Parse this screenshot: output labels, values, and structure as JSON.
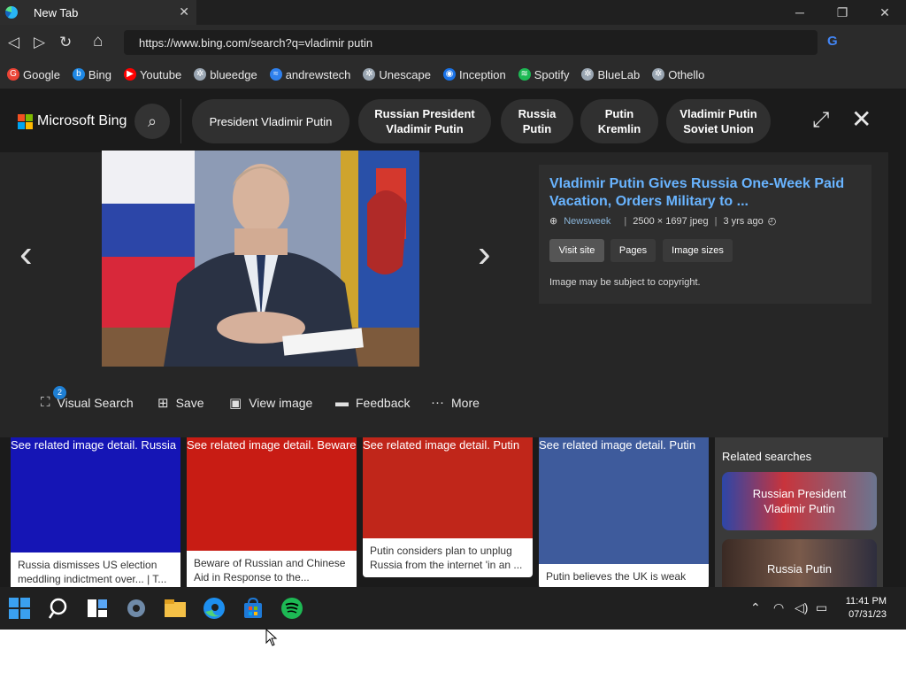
{
  "browser": {
    "tab_title": "New Tab",
    "tab_close": "✕",
    "url": "https://www.bing.com/search?q=vladimir putin",
    "bookmarks": [
      {
        "label": "Google",
        "icon": "google-icon",
        "color": "#ea4335"
      },
      {
        "label": "Bing",
        "icon": "bing-icon",
        "color": "#1e88e5"
      },
      {
        "label": "Youtube",
        "icon": "youtube-icon",
        "color": "#ff0000"
      },
      {
        "label": "blueedge",
        "icon": "gear-icon",
        "color": "#9aa6b2"
      },
      {
        "label": "andrewstech",
        "icon": "link-icon",
        "color": "#2f80ed"
      },
      {
        "label": "Unescape",
        "icon": "gear-icon",
        "color": "#9aa6b2"
      },
      {
        "label": "Inception",
        "icon": "inception-icon",
        "color": "#1a73e8"
      },
      {
        "label": "Spotify",
        "icon": "spotify-icon",
        "color": "#1db954"
      },
      {
        "label": "BlueLab",
        "icon": "gear-icon",
        "color": "#9aa6b2"
      },
      {
        "label": "Othello",
        "icon": "gear-icon",
        "color": "#9aa6b2"
      }
    ]
  },
  "bing": {
    "brand": "Microsoft Bing",
    "chips": [
      {
        "line1": "President Vladimir Putin",
        "line2": ""
      },
      {
        "line1": "Russian President",
        "line2": "Vladimir Putin"
      },
      {
        "line1": "Russia",
        "line2": "Putin"
      },
      {
        "line1": "Putin",
        "line2": "Kremlin"
      },
      {
        "line1": "Vladimir Putin",
        "line2": "Soviet Union"
      }
    ]
  },
  "detail": {
    "title": "Vladimir Putin Gives Russia One-Week Paid Vacation, Orders Military to ...",
    "source": "Newsweek",
    "size": "2500 × 1697 jpeg",
    "age": "3 yrs ago",
    "buttons": {
      "visit": "Visit site",
      "pages": "Pages",
      "sizes": "Image sizes"
    },
    "copyright": "Image may be subject to copyright."
  },
  "actions": {
    "badge": "2",
    "visual_search": "Visual Search",
    "save": "Save",
    "view_image": "View image",
    "feedback": "Feedback",
    "more": "More"
  },
  "cards": [
    {
      "alt": "See related image detail. Russia",
      "caption": "Russia dismisses US election meddling indictment over... | T...",
      "color": "#1515b5"
    },
    {
      "alt": "See related image detail. Beware",
      "caption": "Beware of Russian and Chinese Aid in Response to the...",
      "color": "#c81c14"
    },
    {
      "alt": "See related image detail. Putin",
      "caption": "Putin considers plan to unplug Russia from the internet 'in an ...",
      "color": "#c0261a"
    },
    {
      "alt": "See related image detail. Putin",
      "caption": "Putin believes the UK is weak",
      "color": "#3e5b9c"
    }
  ],
  "related": {
    "heading": "Related searches",
    "items": [
      {
        "line1": "Russian President",
        "line2": "Vladimir Putin"
      },
      {
        "line1": "Russia Putin",
        "line2": ""
      }
    ]
  },
  "taskbar": {
    "time": "11:41 PM",
    "date": "07/31/23"
  },
  "colors": {
    "bing_link": "#69b4ff",
    "page_bg": "#1b1b1b"
  }
}
